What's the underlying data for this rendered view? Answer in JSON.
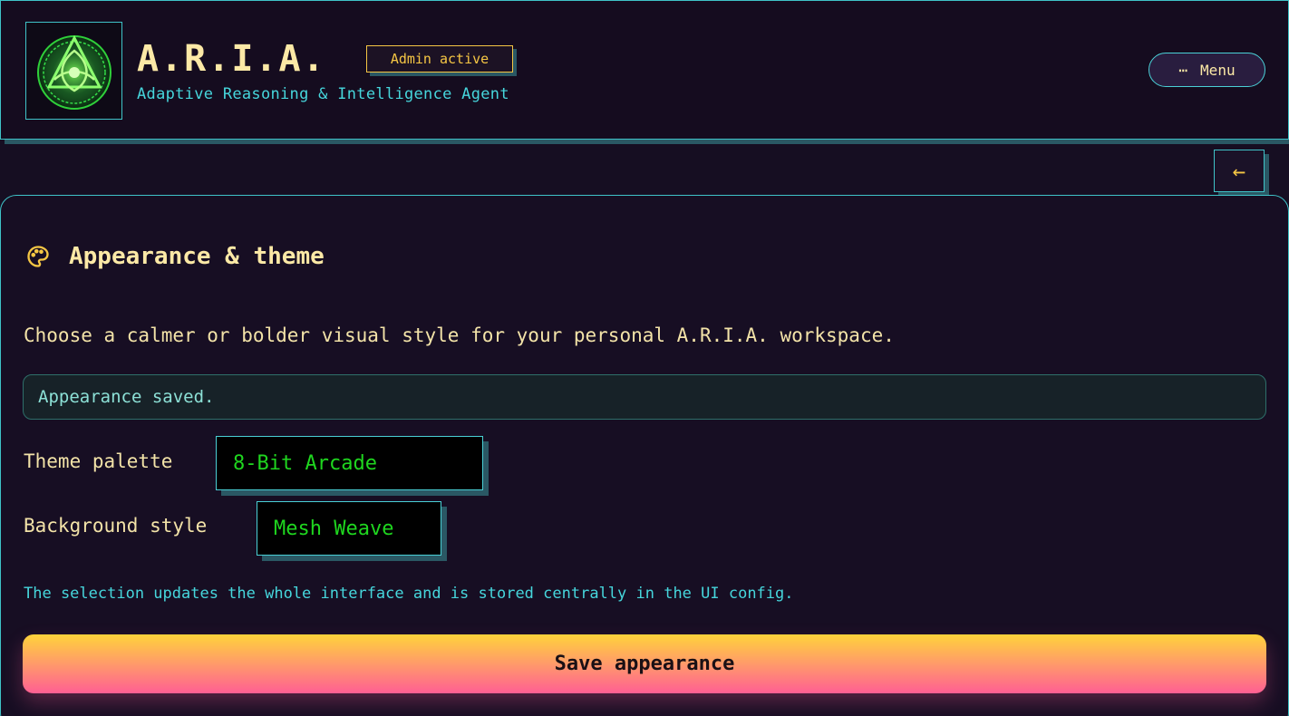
{
  "header": {
    "title": "A.R.I.A.",
    "badge": "Admin active",
    "subtitle": "Adaptive Reasoning & Intelligence Agent",
    "menu_label": "Menu",
    "menu_icon": "ellipsis-icon",
    "logo_icon": "triquetra-emblem-icon"
  },
  "nav": {
    "back_icon": "arrow-left-icon",
    "back_glyph": "←"
  },
  "appearance": {
    "section_icon": "palette-icon",
    "title": "Appearance & theme",
    "description": "Choose a calmer or bolder visual style for your personal A.R.I.A. workspace.",
    "status": "Appearance saved.",
    "theme_label": "Theme palette",
    "theme_value": "8-Bit Arcade",
    "background_label": "Background style",
    "background_value": "Mesh Weave",
    "hint": "The selection updates the whole interface and is stored centrally in the UI config.",
    "save_label": "Save appearance"
  },
  "colors": {
    "accent_cyan": "#3fc3c8",
    "accent_gold": "#f5c644",
    "select_text": "#1fd61f",
    "background": "#160e22"
  }
}
